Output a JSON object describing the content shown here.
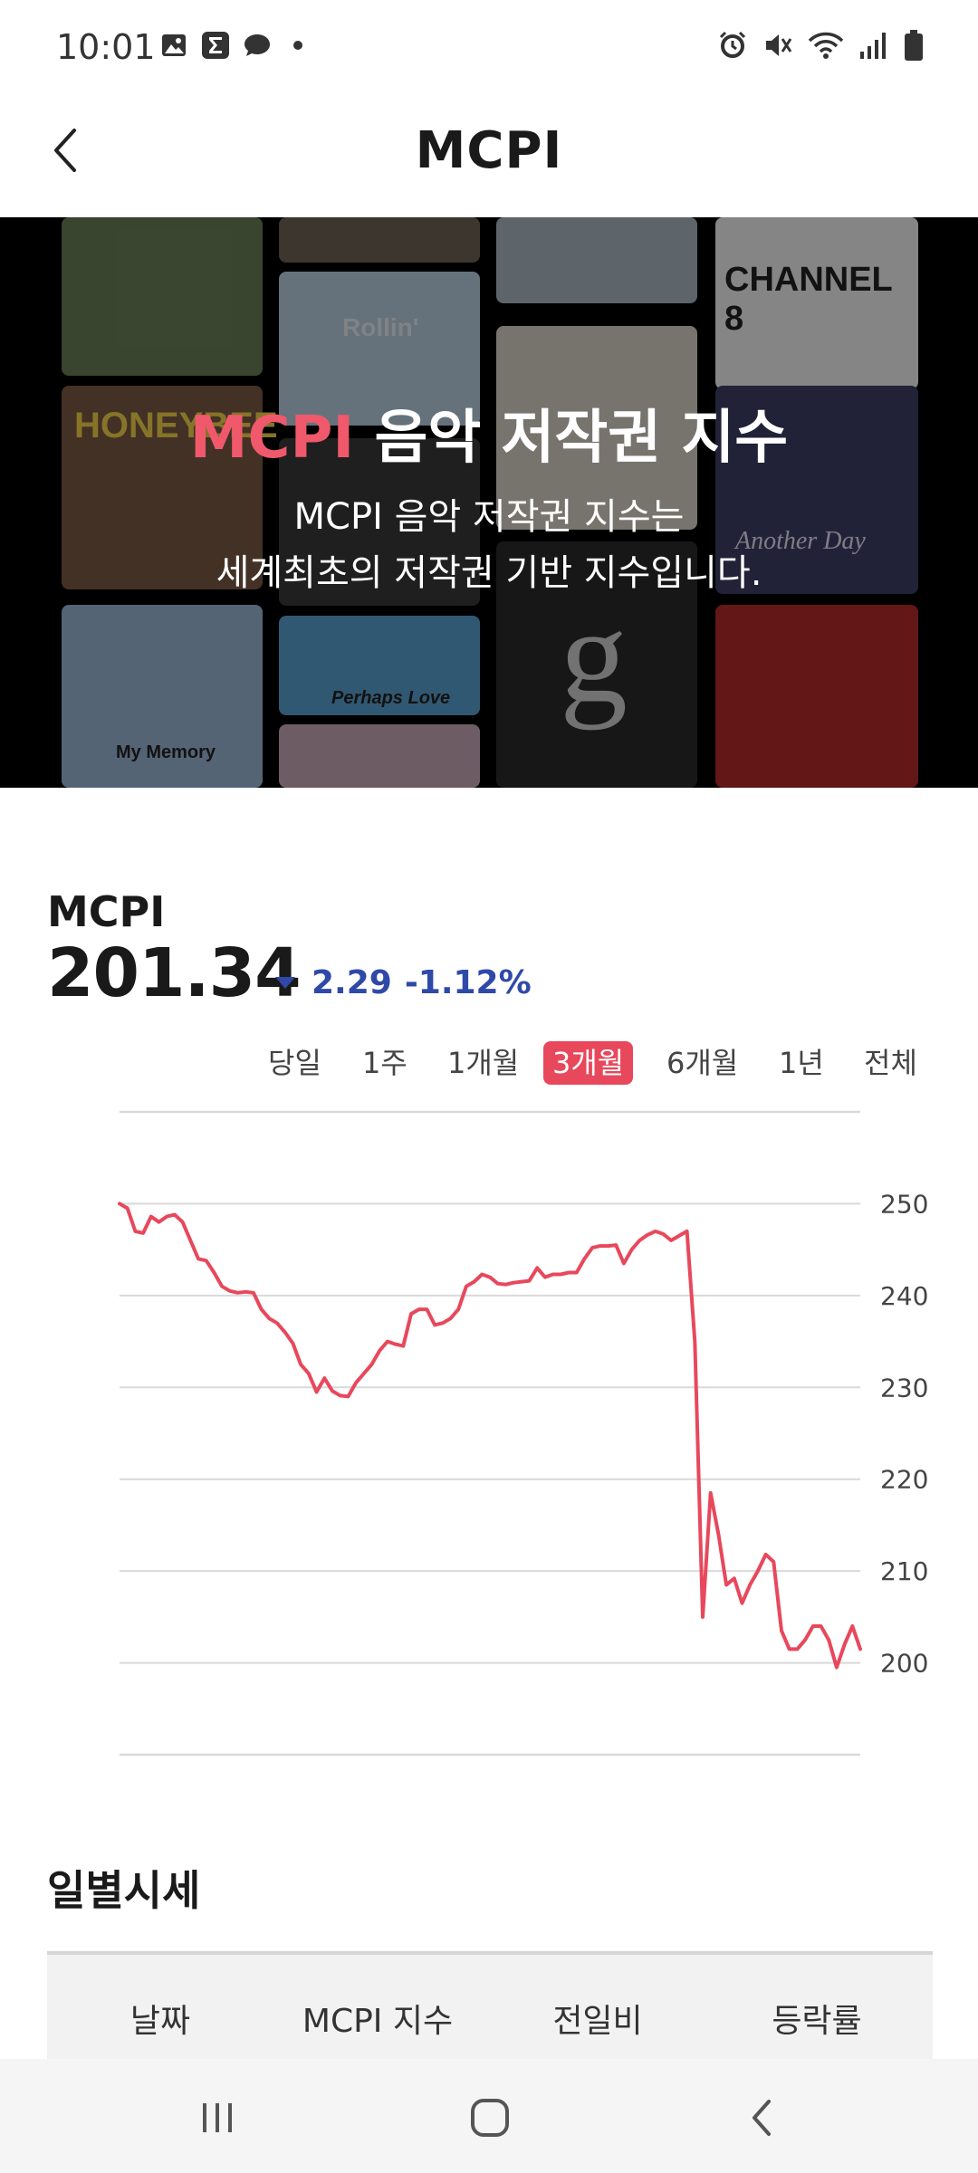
{
  "status_bar": {
    "time": "10:01",
    "left_icons": [
      "gallery-icon",
      "sigma-app-icon",
      "chat-bubble-icon",
      "dot-icon"
    ],
    "right_icons": [
      "alarm-icon",
      "mute-icon",
      "wifi-icon",
      "signal-icon",
      "battery-icon"
    ]
  },
  "app_bar": {
    "title": "MCPI",
    "back_icon": "chevron-left-icon"
  },
  "banner": {
    "title_accent": "MCPI",
    "title_rest": " 음악 저작권 지수",
    "desc_line1": "MCPI 음악 저작권 지수는",
    "desc_line2": "세계최초의 저작권 기반 지수입니다.",
    "tile_texts": [
      "HONEYBEE",
      "CHANNEL 8",
      "Rollin'",
      "Another Day",
      "My Memory",
      "Perhaps Love",
      "g"
    ]
  },
  "summary": {
    "label": "MCPI",
    "value": "201.34",
    "change": "2.29",
    "change_pct": "-1.12%",
    "direction": "down",
    "color_down": "#2f49a8",
    "color_accent": "#e8485c"
  },
  "period_tabs": {
    "items": [
      "당일",
      "1주",
      "1개월",
      "3개월",
      "6개월",
      "1년",
      "전체"
    ],
    "selected": "3개월"
  },
  "chart_data": {
    "type": "line",
    "title": "",
    "xlabel": "",
    "ylabel": "",
    "ylim": [
      190,
      260
    ],
    "yticks": [
      200,
      210,
      220,
      230,
      240,
      250
    ],
    "grid": true,
    "line_color": "#e8485c",
    "series": [
      {
        "values": [
          250,
          249.5,
          247,
          246.8,
          248.6,
          248,
          248.6,
          248.8,
          248,
          246,
          244,
          243.8,
          242.5,
          241,
          240.5,
          240.3,
          240.4,
          240.3,
          238.5,
          237.5,
          237,
          236,
          234.8,
          232.5,
          231.5,
          229.5,
          231,
          229.6,
          229.1,
          229,
          230.5,
          231.5,
          232.5,
          234,
          235,
          234.7,
          234.5,
          238,
          238.5,
          238.5,
          236.8,
          237,
          237.5,
          238.5,
          241,
          241.5,
          242.3,
          242,
          241.3,
          241.2,
          241.4,
          241.5,
          241.6,
          243,
          242,
          242.3,
          242.3,
          242.5,
          242.5,
          244,
          245.2,
          245.4,
          245.4,
          245.5,
          243.5,
          245,
          246,
          246.6,
          247,
          246.7,
          246,
          246.5,
          247,
          235,
          205,
          218.5,
          214,
          208.5,
          209.2,
          206.5,
          208.5,
          210,
          211.8,
          211,
          203.5,
          201.5,
          201.5,
          202.5,
          204,
          204,
          202.5,
          199.5,
          202,
          204,
          201.5
        ]
      }
    ]
  },
  "daily": {
    "title": "일별시세",
    "columns": [
      "날짜",
      "MCPI 지수",
      "전일비",
      "등락률"
    ]
  },
  "nav_bar": {
    "items": [
      "recent-apps-icon",
      "home-icon",
      "back-icon"
    ]
  }
}
